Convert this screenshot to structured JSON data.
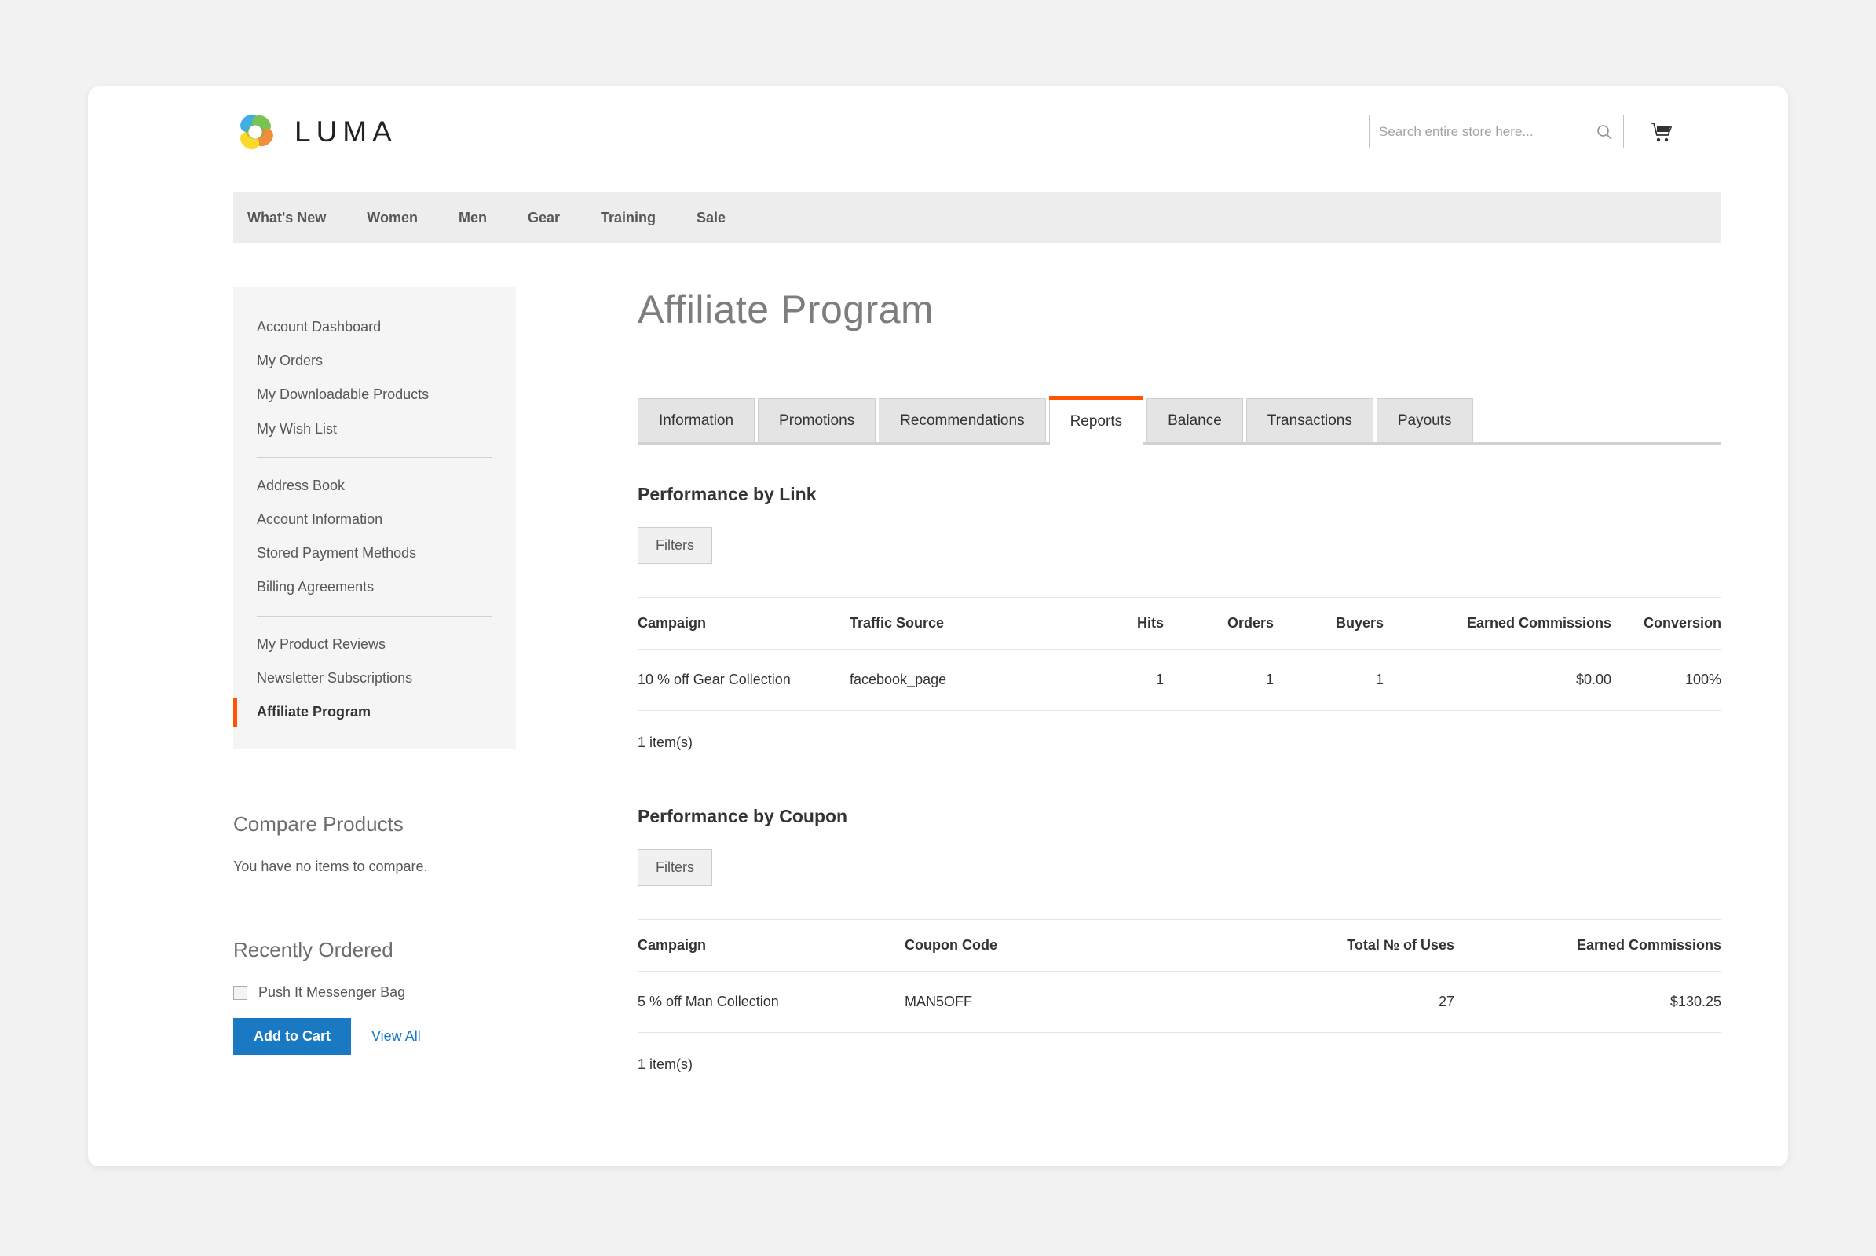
{
  "header": {
    "brand_name": "LUMA",
    "search": {
      "placeholder": "Search entire store here...",
      "value": "",
      "icon": "search-icon"
    },
    "cart_icon": "shopping-cart-icon"
  },
  "main_nav": {
    "items": [
      {
        "label": "What's New"
      },
      {
        "label": "Women"
      },
      {
        "label": "Men"
      },
      {
        "label": "Gear"
      },
      {
        "label": "Training"
      },
      {
        "label": "Sale"
      }
    ]
  },
  "sidebar": {
    "account_nav_groups": [
      {
        "items": [
          {
            "label": "Account Dashboard",
            "current": false
          },
          {
            "label": "My Orders",
            "current": false
          },
          {
            "label": "My Downloadable Products",
            "current": false
          },
          {
            "label": "My Wish List",
            "current": false
          }
        ]
      },
      {
        "items": [
          {
            "label": "Address Book",
            "current": false
          },
          {
            "label": "Account Information",
            "current": false
          },
          {
            "label": "Stored Payment Methods",
            "current": false
          },
          {
            "label": "Billing Agreements",
            "current": false
          }
        ]
      },
      {
        "items": [
          {
            "label": "My Product Reviews",
            "current": false
          },
          {
            "label": "Newsletter Subscriptions",
            "current": false
          },
          {
            "label": "Affiliate Program",
            "current": true
          }
        ]
      }
    ],
    "compare_products": {
      "title": "Compare Products",
      "empty_text": "You have no items to compare."
    },
    "recently_ordered": {
      "title": "Recently Ordered",
      "items": [
        {
          "label": "Push It Messenger Bag",
          "checked": false
        }
      ],
      "add_to_cart_label": "Add to Cart",
      "view_all_label": "View All"
    }
  },
  "main": {
    "page_title": "Affiliate Program",
    "tabs": [
      {
        "label": "Information",
        "active": false
      },
      {
        "label": "Promotions",
        "active": false
      },
      {
        "label": "Recommendations",
        "active": false
      },
      {
        "label": "Reports",
        "active": true
      },
      {
        "label": "Balance",
        "active": false
      },
      {
        "label": "Transactions",
        "active": false
      },
      {
        "label": "Payouts",
        "active": false
      }
    ],
    "performance_by_link": {
      "title": "Performance by Link",
      "filters_label": "Filters",
      "columns": [
        "Campaign",
        "Traffic Source",
        "Hits",
        "Orders",
        "Buyers",
        "Earned Commissions",
        "Conversion"
      ],
      "rows": [
        {
          "campaign": "10 % off Gear Collection",
          "traffic_source": "facebook_page",
          "hits": "1",
          "orders": "1",
          "buyers": "1",
          "earned_commissions": "$0.00",
          "conversion": "100%"
        }
      ],
      "item_count": "1 item(s)"
    },
    "performance_by_coupon": {
      "title": "Performance by Coupon",
      "filters_label": "Filters",
      "columns": [
        "Campaign",
        "Coupon Code",
        "Total № of Uses",
        "Earned Commissions"
      ],
      "rows": [
        {
          "campaign": "5 % off Man Collection",
          "coupon_code": "MAN5OFF",
          "total_uses": "27",
          "earned_commissions": "$130.25"
        }
      ],
      "item_count": "1 item(s)"
    }
  },
  "colors": {
    "accent_orange": "#ff5501",
    "link_blue": "#1979c3",
    "nav_bg": "#ededed",
    "panel_bg": "#f5f5f5"
  }
}
